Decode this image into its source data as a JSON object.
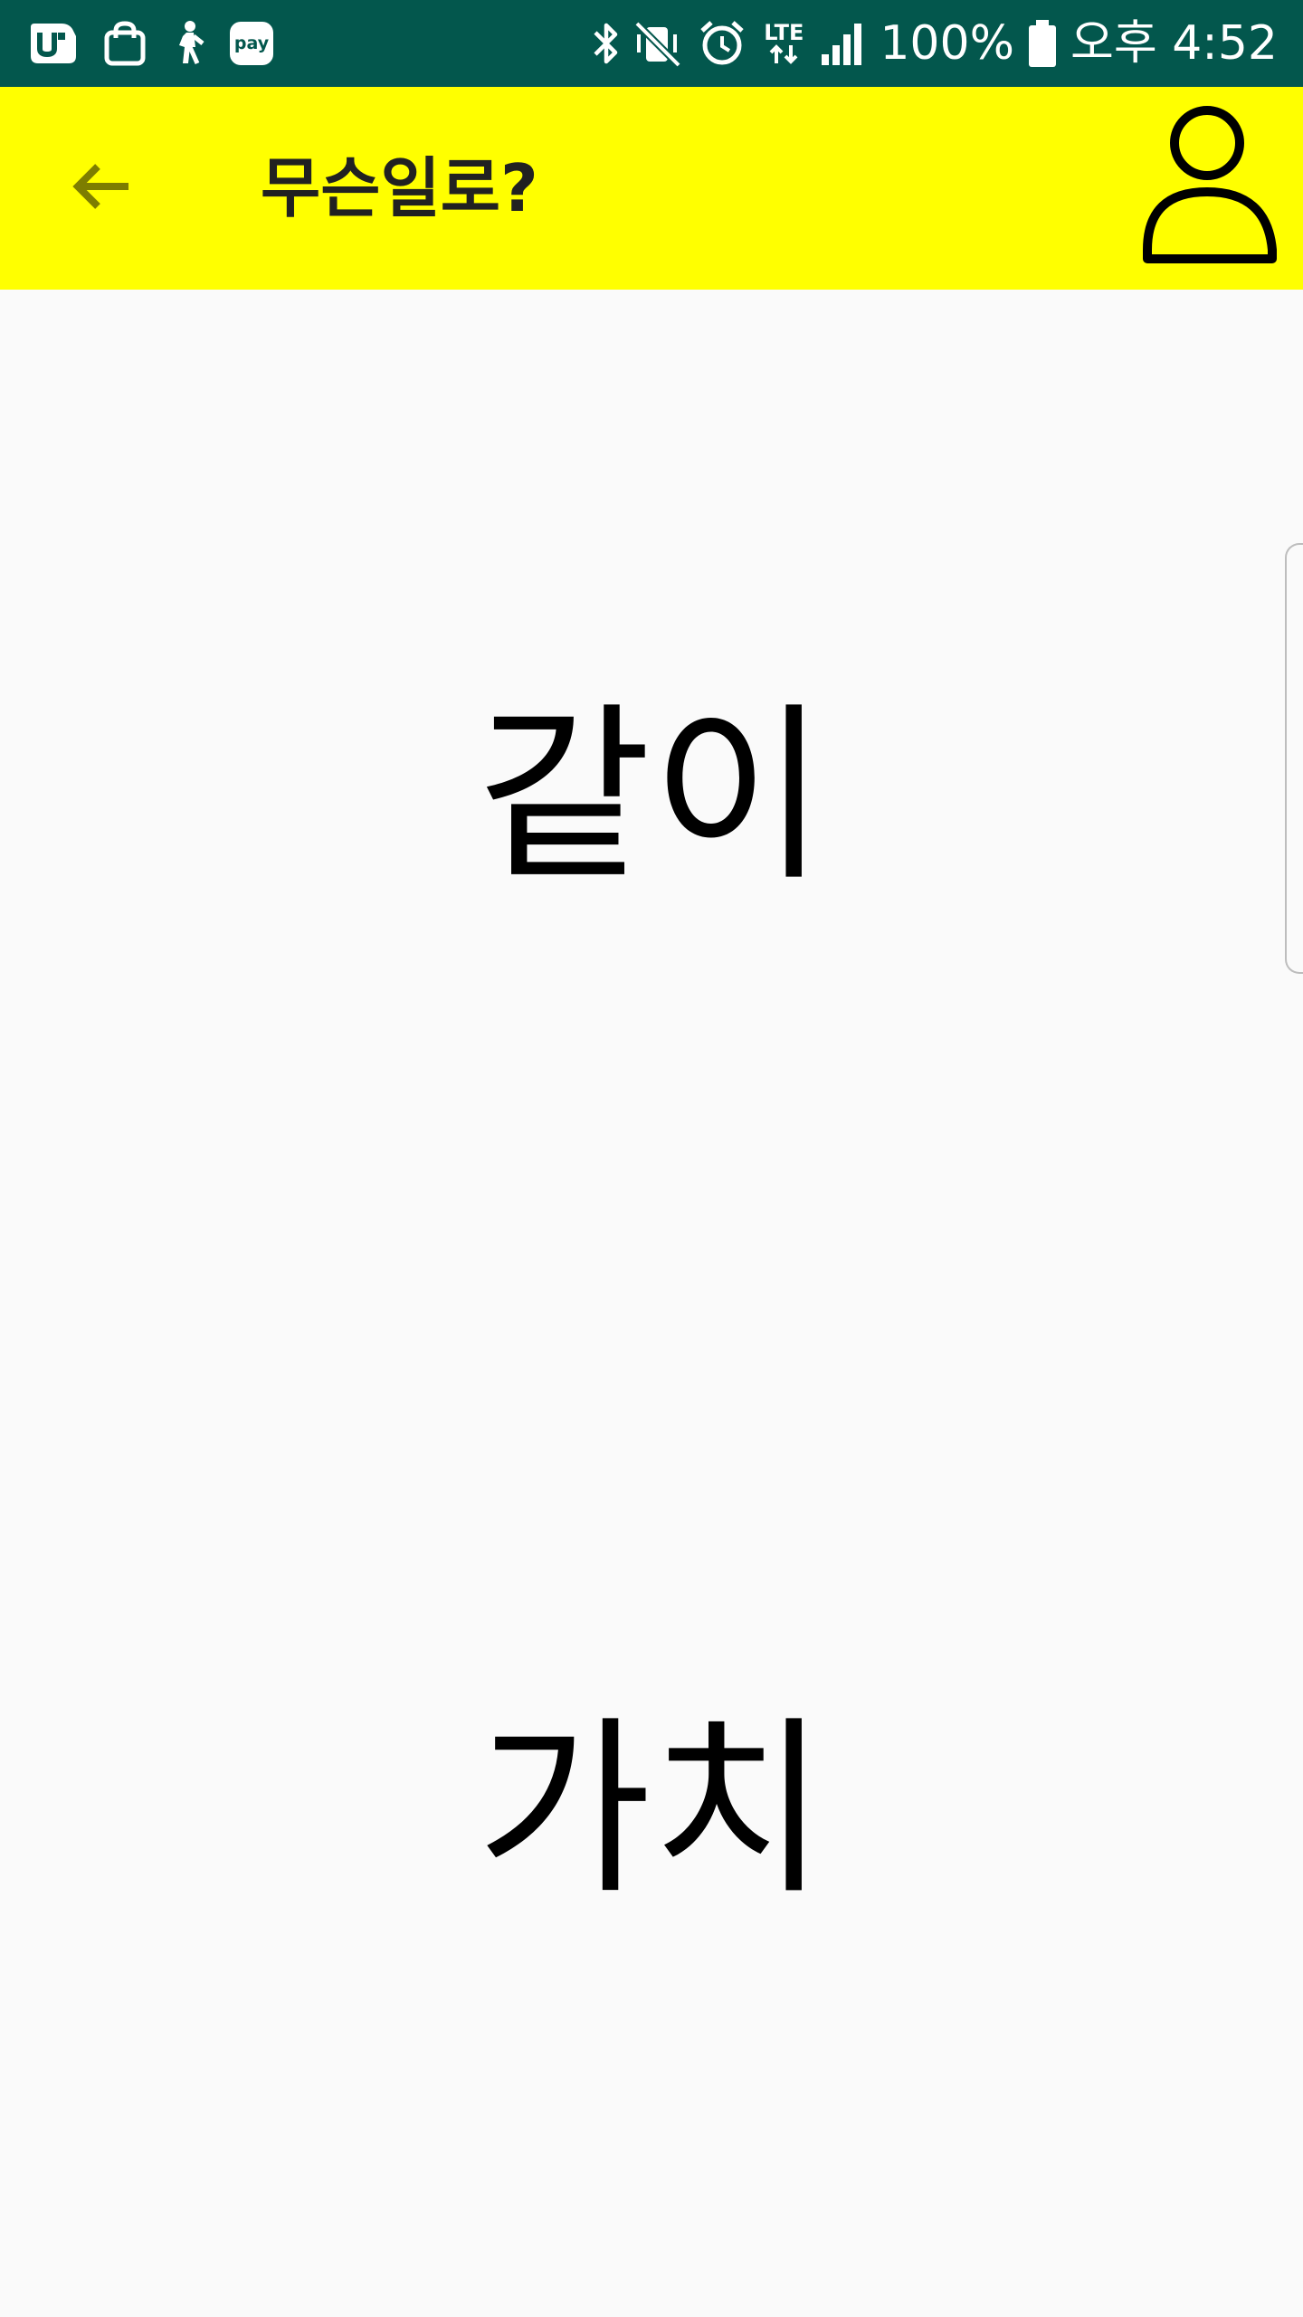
{
  "status_bar": {
    "background": "#03574d",
    "left_icons": [
      "u-plus-icon",
      "shopping-bag-icon",
      "walking-person-icon",
      "pay-icon"
    ],
    "pay_label": "pay",
    "lte_label": "LTE",
    "battery_percent": "100%",
    "clock": "오후 4:52"
  },
  "app_bar": {
    "background": "#ffff00",
    "title": "무슨일로?",
    "back_icon": "arrow-left-icon",
    "profile_icon": "person-outline-icon"
  },
  "main": {
    "word_top": "같이",
    "word_bottom": "가치"
  }
}
